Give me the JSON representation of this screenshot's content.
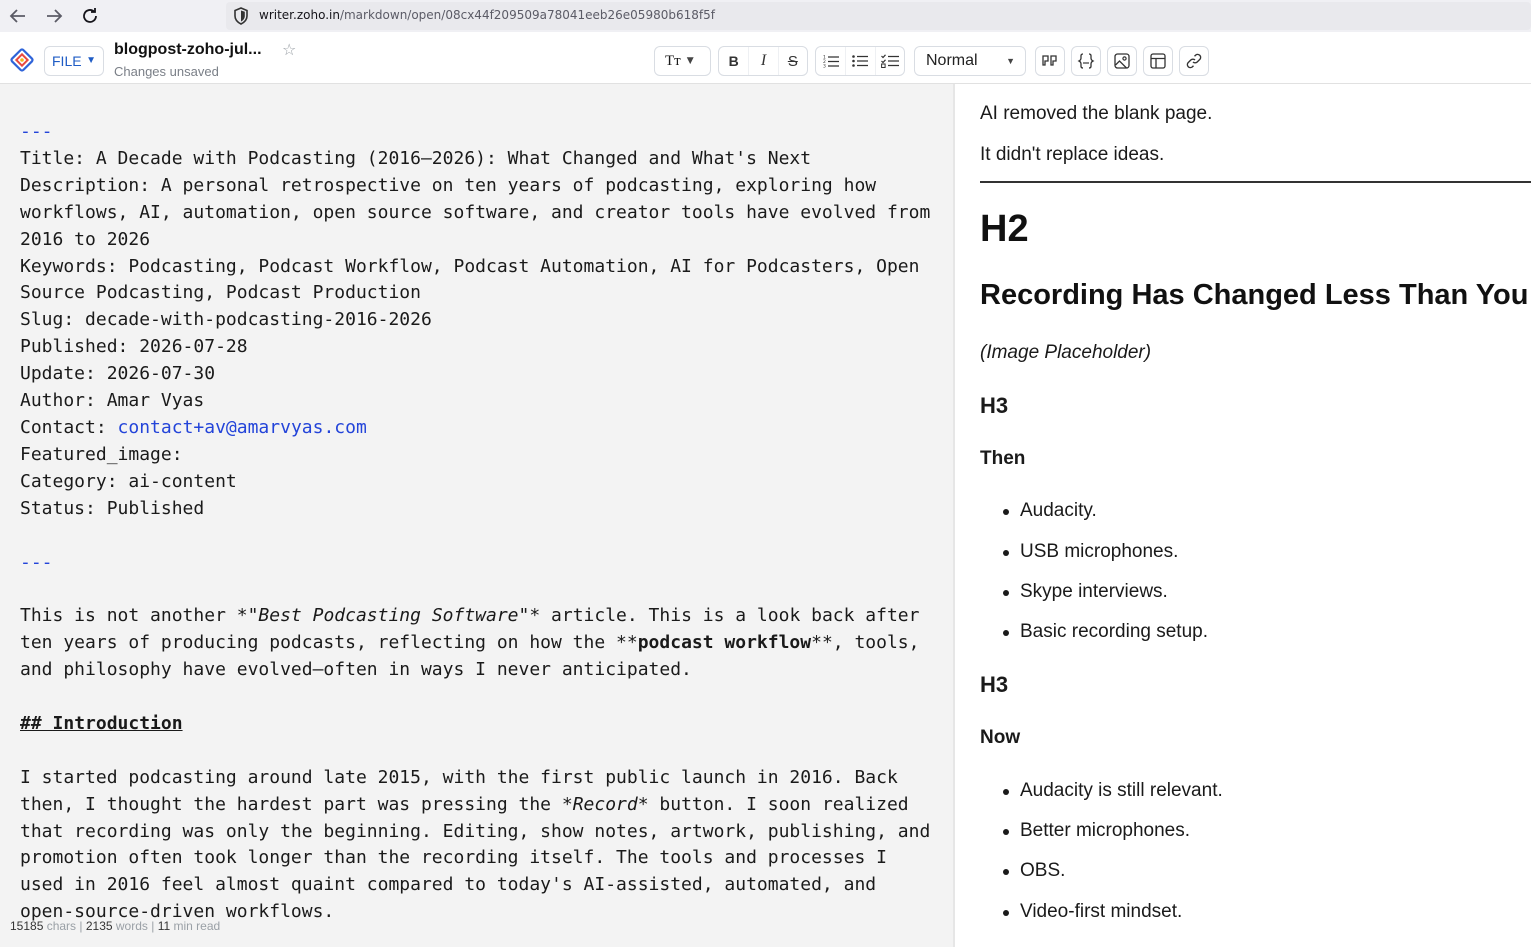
{
  "browser": {
    "url_host": "writer.zoho.in",
    "url_path": "/markdown/open/08cx44f209509a78041eeb26e05980b618f5f"
  },
  "toolbar": {
    "file_label": "FILE",
    "doc_title": "blogpost-zoho-jul...",
    "save_status": "Changes unsaved",
    "text_size_label": "Tт",
    "bold": "B",
    "italic": "I",
    "strike": "S",
    "style_value": "Normal"
  },
  "editor": {
    "sep1": "---",
    "frontmatter": [
      "Title: A Decade with Podcasting (2016–2026): What Changed and What's Next",
      "Description: A personal retrospective on ten years of podcasting, exploring how workflows, AI, automation, open source software, and creator tools have evolved from 2016 to 2026",
      "Keywords: Podcasting, Podcast Workflow, Podcast Automation, AI for Podcasters, Open Source Podcasting, Podcast Production",
      "Slug: decade-with-podcasting-2016-2026",
      "Published: 2026-07-28",
      "Update: 2026-07-30",
      "Author: Amar Vyas"
    ],
    "contact_label": "Contact: ",
    "contact_email": "contact+av@amarvyas.com",
    "frontmatter2": [
      "Featured_image:",
      "Category: ai-content",
      "Status: Published"
    ],
    "sep2": "---",
    "intro_p1_a": "This is not another *\"",
    "intro_p1_em": "Best Podcasting Software",
    "intro_p1_b": "\"* article. This is a look back after ten years of producing podcasts, reflecting on how the **",
    "intro_p1_strong": "podcast workflow",
    "intro_p1_c": "**, tools, and philosophy have evolved—often in ways I never anticipated.",
    "heading_marker": "## ",
    "heading_text": "Introduction",
    "intro_p2_a": "I started podcasting around late 2015, with the first public launch in 2016. Back then, I thought the hardest part was pressing the *",
    "intro_p2_em": "Record",
    "intro_p2_b": "* button. I soon realized that recording was only the beginning. Editing, show notes, artwork, publishing, and promotion often took longer than the recording itself. The tools and processes I used in 2016 feel almost quaint compared to today's AI-assisted, automated, and open-source-driven workflows."
  },
  "status_bar": {
    "chars": "15185",
    "chars_label": " chars | ",
    "words": "2135",
    "words_label": " words | ",
    "read": "11",
    "read_label": " min read"
  },
  "preview": {
    "p1": "AI removed the blank page.",
    "p2": "It didn't replace ideas.",
    "h2_marker": "H2",
    "h2_text": "Recording Has Changed Less Than You",
    "image_placeholder": "(Image Placeholder)",
    "h3_marker_1": "H3",
    "then_heading": "Then",
    "then_items": [
      "Audacity.",
      "USB microphones.",
      "Skype interviews.",
      "Basic recording setup."
    ],
    "h3_marker_2": "H3",
    "now_heading": "Now",
    "now_items": [
      "Audacity is still relevant.",
      "Better microphones.",
      "OBS.",
      "Video-first mindset."
    ]
  }
}
